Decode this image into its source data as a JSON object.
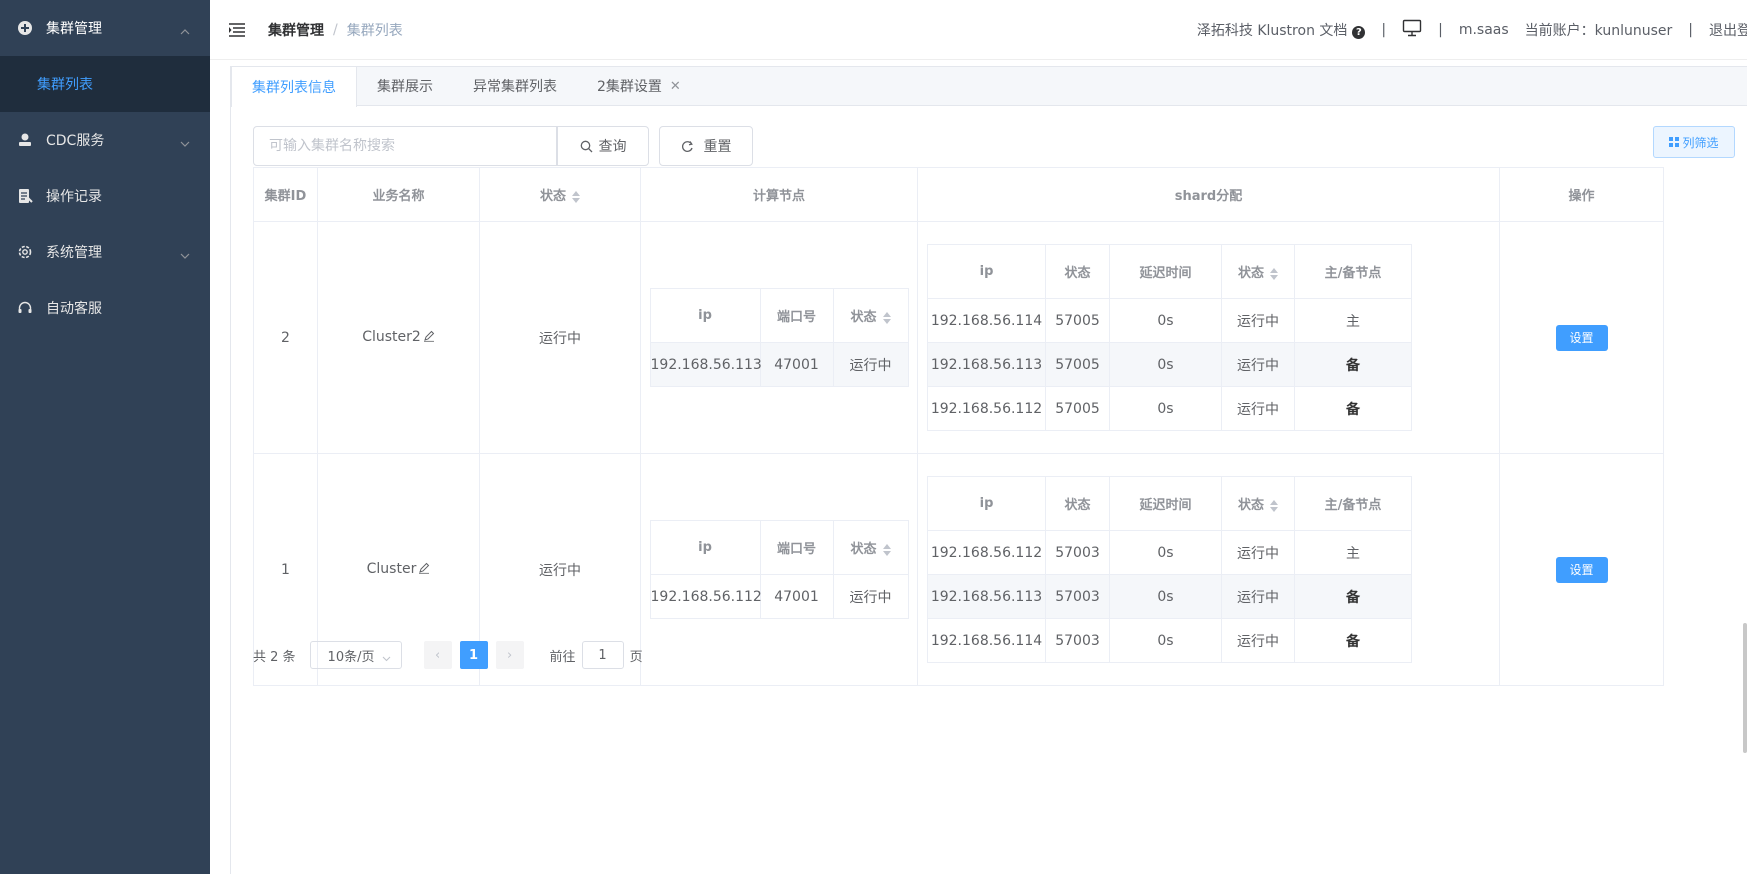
{
  "sidebar": {
    "items": [
      {
        "label": "集群管理",
        "icon": "cluster-icon",
        "expanded": true
      },
      {
        "label": "集群列表",
        "active": true
      },
      {
        "label": "CDC服务",
        "icon": "user-icon"
      },
      {
        "label": "操作记录",
        "icon": "log-icon"
      },
      {
        "label": "系统管理",
        "icon": "gear-icon"
      },
      {
        "label": "自动客服",
        "icon": "headset-icon"
      }
    ]
  },
  "header": {
    "breadcrumb": [
      "集群管理",
      "/",
      "集群列表"
    ],
    "docs_label": "泽拓科技 Klustron 文档",
    "help_glyph": "?",
    "pipe": "|",
    "saas": "m.saas",
    "account_label": "当前账户：kunlunuser",
    "logout": "退出登录"
  },
  "tabs": [
    {
      "label": "集群列表信息",
      "active": true
    },
    {
      "label": "集群展示"
    },
    {
      "label": "异常集群列表"
    },
    {
      "label": "2集群设置",
      "closable": true,
      "close_glyph": "✕"
    }
  ],
  "toolbar": {
    "search_placeholder": "可输入集群名称搜索",
    "query_label": "查询",
    "reset_label": "重置",
    "filter_label": "列筛选"
  },
  "table": {
    "headers": [
      "集群ID",
      "业务名称",
      "状态",
      "计算节点",
      "shard分配",
      "操作"
    ],
    "comp_headers": [
      "ip",
      "端口号",
      "状态"
    ],
    "shard_headers": [
      "ip",
      "状态",
      "延迟时间",
      "状态",
      "主/备节点"
    ],
    "rows": [
      {
        "id": "2",
        "name": "Cluster2",
        "status": "运行中",
        "comp": [
          {
            "ip": "192.168.56.113",
            "port": "47001",
            "status": "运行中"
          }
        ],
        "shards": [
          {
            "ip": "192.168.56.114",
            "port": "57005",
            "delay": "0s",
            "status": "运行中",
            "role": "主"
          },
          {
            "ip": "192.168.56.113",
            "port": "57005",
            "delay": "0s",
            "status": "运行中",
            "role": "备"
          },
          {
            "ip": "192.168.56.112",
            "port": "57005",
            "delay": "0s",
            "status": "运行中",
            "role": "备"
          }
        ],
        "action": "设置"
      },
      {
        "id": "1",
        "name": "Cluster",
        "status": "运行中",
        "comp": [
          {
            "ip": "192.168.56.112",
            "port": "47001",
            "status": "运行中"
          }
        ],
        "shards": [
          {
            "ip": "192.168.56.112",
            "port": "57003",
            "delay": "0s",
            "status": "运行中",
            "role": "主"
          },
          {
            "ip": "192.168.56.113",
            "port": "57003",
            "delay": "0s",
            "status": "运行中",
            "role": "备"
          },
          {
            "ip": "192.168.56.114",
            "port": "57003",
            "delay": "0s",
            "status": "运行中",
            "role": "备"
          }
        ],
        "action": "设置"
      }
    ]
  },
  "pagination": {
    "total": "共 2 条",
    "page_size": "10条/页",
    "current_page": "1",
    "prev_glyph": "‹",
    "next_glyph": "›",
    "goto_label": "前往",
    "goto_value": "1",
    "page_suffix": "页"
  },
  "colors": {
    "sidebar_bg": "#304156",
    "accent": "#409eff",
    "running": "#13ce66"
  }
}
